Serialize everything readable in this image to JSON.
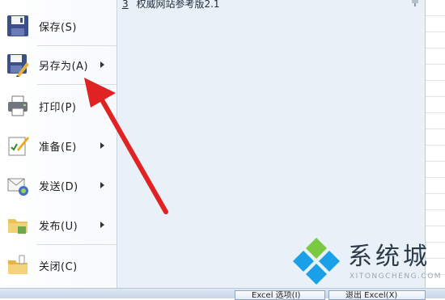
{
  "menu": {
    "items": [
      {
        "label": "保存(S)",
        "icon": "save-icon"
      },
      {
        "label": "另存为(A)",
        "icon": "save-as-icon",
        "submenu": true
      },
      {
        "label": "打印(P)",
        "icon": "print-icon"
      },
      {
        "label": "准备(E)",
        "icon": "prepare-icon",
        "submenu": true
      },
      {
        "label": "发送(D)",
        "icon": "send-icon",
        "submenu": true
      },
      {
        "label": "发布(U)",
        "icon": "publish-icon",
        "submenu": true
      },
      {
        "label": "关闭(C)",
        "icon": "folder-close-icon"
      }
    ]
  },
  "recent": {
    "items": [
      {
        "number": "3",
        "title": "权威网站参考版2.1"
      }
    ]
  },
  "bottom_bar": {
    "options_label": "Excel 选项(I)",
    "exit_label": "退出 Excel(X)"
  },
  "watermark": {
    "title": "系统城",
    "subtitle": "XITONGCHENG.COM"
  },
  "colors": {
    "pane_bg": "#eaf0f8",
    "arrow": "#e02222",
    "logo_blue": "#1aa0e6"
  }
}
